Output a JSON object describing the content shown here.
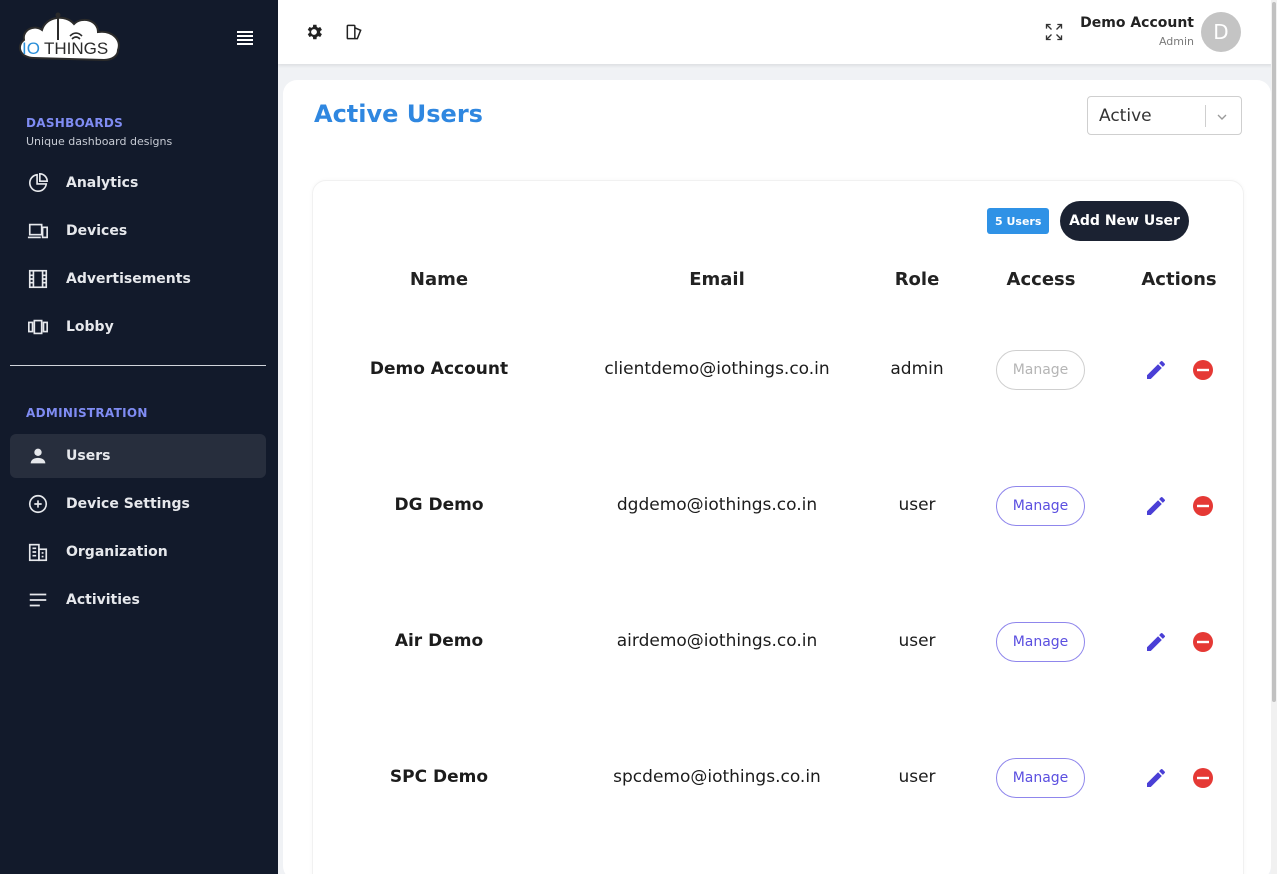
{
  "logo": {
    "text_io": "IO",
    "text_things": "THINGS"
  },
  "sidebar": {
    "dashboards_title": "DASHBOARDS",
    "dashboards_sub": "Unique dashboard designs",
    "dashboards_items": [
      {
        "label": "Analytics",
        "icon": "pie-chart-icon"
      },
      {
        "label": "Devices",
        "icon": "devices-icon"
      },
      {
        "label": "Advertisements",
        "icon": "film-icon"
      },
      {
        "label": "Lobby",
        "icon": "lobby-icon"
      }
    ],
    "admin_title": "ADMINISTRATION",
    "admin_items": [
      {
        "label": "Users",
        "icon": "user-icon",
        "active": true
      },
      {
        "label": "Device Settings",
        "icon": "plus-circle-icon"
      },
      {
        "label": "Organization",
        "icon": "building-icon"
      },
      {
        "label": "Activities",
        "icon": "lines-icon"
      }
    ]
  },
  "topbar": {
    "account_name": "Demo Account",
    "account_role": "Admin",
    "avatar_initial": "D"
  },
  "main": {
    "title": "Active Users",
    "filter_value": "Active",
    "user_count": "5 Users",
    "add_button": "Add New User",
    "columns": [
      "Name",
      "Email",
      "Role",
      "Access",
      "Actions"
    ],
    "manage_label": "Manage",
    "rows": [
      {
        "name": "Demo Account",
        "email": "clientdemo@iothings.co.in",
        "role": "admin",
        "manage_disabled": true
      },
      {
        "name": "DG Demo",
        "email": "dgdemo@iothings.co.in",
        "role": "user",
        "manage_disabled": false
      },
      {
        "name": "Air Demo",
        "email": "airdemo@iothings.co.in",
        "role": "user",
        "manage_disabled": false
      },
      {
        "name": "SPC Demo",
        "email": "spcdemo@iothings.co.in",
        "role": "user",
        "manage_disabled": false
      }
    ]
  },
  "colors": {
    "sidebar_bg": "#121a2b",
    "accent_blue": "#2f87e0",
    "section_title": "#7f8cf3",
    "edit_icon": "#4a3fd6",
    "delete_icon": "#e53935"
  }
}
